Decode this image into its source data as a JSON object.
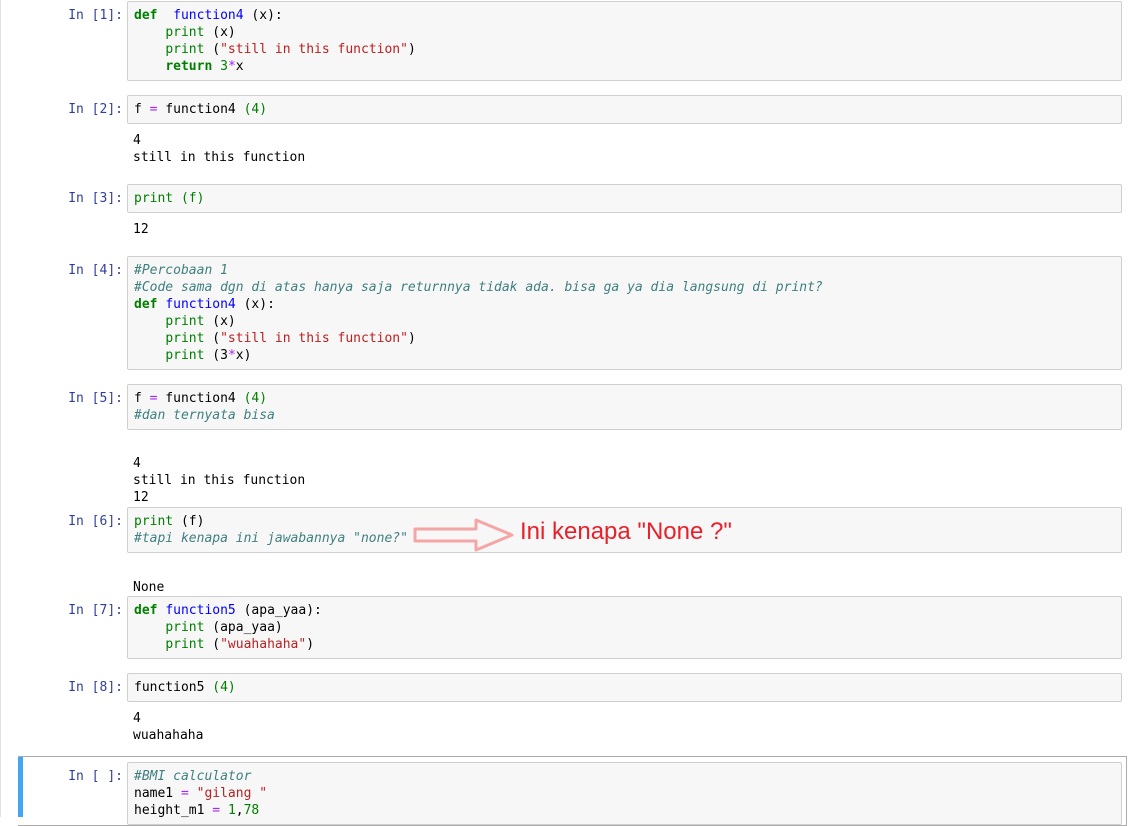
{
  "cells": [
    {
      "prompt": "In [1]:",
      "code": [
        [
          [
            "kw",
            "def"
          ],
          [
            "",
            "  "
          ],
          [
            "fn",
            "function4"
          ],
          [
            "",
            " (x):"
          ]
        ],
        [
          [
            "",
            "    "
          ],
          [
            "bi",
            "print"
          ],
          [
            "",
            " (x)"
          ]
        ],
        [
          [
            "",
            "    "
          ],
          [
            "bi",
            "print"
          ],
          [
            "",
            " ("
          ],
          [
            "str",
            "\"still in this function\""
          ],
          [
            "",
            ")"
          ]
        ],
        [
          [
            "",
            "    "
          ],
          [
            "kw",
            "return"
          ],
          [
            "",
            " "
          ],
          [
            "num",
            "3"
          ],
          [
            "op",
            "*"
          ],
          [
            "",
            "x"
          ]
        ]
      ],
      "output": []
    },
    {
      "prompt": "In [2]:",
      "code": [
        [
          [
            "",
            "f "
          ],
          [
            "op",
            "="
          ],
          [
            "",
            " function4 "
          ],
          [
            "num",
            "(4)"
          ]
        ]
      ],
      "output": [
        "4",
        "still in this function"
      ]
    },
    {
      "prompt": "In [3]:",
      "code": [
        [
          [
            "bi",
            "print"
          ],
          [
            "bi",
            " (f)"
          ]
        ]
      ],
      "output": [
        "12"
      ]
    },
    {
      "prompt": "In [4]:",
      "code": [
        [
          [
            "cm",
            "#Percobaan 1"
          ]
        ],
        [
          [
            "cm",
            "#Code sama dgn di atas hanya saja returnnya tidak ada. bisa ga ya dia langsung di print?"
          ]
        ],
        [
          [
            "kw",
            "def"
          ],
          [
            "",
            " "
          ],
          [
            "fn",
            "function4"
          ],
          [
            "",
            " (x):"
          ]
        ],
        [
          [
            "",
            "    "
          ],
          [
            "bi",
            "print"
          ],
          [
            "",
            " (x)"
          ]
        ],
        [
          [
            "",
            "    "
          ],
          [
            "bi",
            "print"
          ],
          [
            "",
            " ("
          ],
          [
            "str",
            "\"still in this function\""
          ],
          [
            "",
            ")"
          ]
        ],
        [
          [
            "",
            "    "
          ],
          [
            "bi",
            "print"
          ],
          [
            "",
            " (3"
          ],
          [
            "op",
            "*"
          ],
          [
            "",
            "x)"
          ]
        ]
      ],
      "output": []
    },
    {
      "prompt": "In [5]:",
      "code": [
        [
          [
            "",
            "f "
          ],
          [
            "op",
            "="
          ],
          [
            "",
            " function4 "
          ],
          [
            "num",
            "(4)"
          ]
        ],
        [
          [
            "cm",
            "#dan ternyata bisa"
          ]
        ]
      ],
      "output": [
        "4",
        "still in this function",
        "12"
      ]
    },
    {
      "prompt": "In [6]:",
      "code": [
        [
          [
            "bi",
            "print"
          ],
          [
            "",
            " (f)"
          ]
        ],
        [
          [
            "cm",
            "#tapi kenapa ini jawabannya \"none?\""
          ]
        ]
      ],
      "output": [
        "None"
      ]
    },
    {
      "prompt": "In [7]:",
      "code": [
        [
          [
            "kw",
            "def"
          ],
          [
            "",
            " "
          ],
          [
            "fn",
            "function5"
          ],
          [
            "",
            " (apa_yaa):"
          ]
        ],
        [
          [
            "",
            "    "
          ],
          [
            "bi",
            "print"
          ],
          [
            "",
            " (apa_yaa)"
          ]
        ],
        [
          [
            "",
            "    "
          ],
          [
            "bi",
            "print"
          ],
          [
            "",
            " ("
          ],
          [
            "str",
            "\"wuahahaha\""
          ],
          [
            "",
            ")"
          ]
        ]
      ],
      "output": []
    },
    {
      "prompt": "In [8]:",
      "code": [
        [
          [
            "",
            "function5 "
          ],
          [
            "num",
            "(4)"
          ]
        ]
      ],
      "output": [
        "4",
        "wuahahaha"
      ]
    },
    {
      "prompt": "In [ ]:",
      "code": [
        [
          [
            "cm",
            "#BMI calculator"
          ]
        ],
        [
          [
            "",
            "name1 "
          ],
          [
            "op",
            "="
          ],
          [
            "",
            " "
          ],
          [
            "str",
            "\"gilang \""
          ]
        ],
        [
          [
            "",
            "height_m1 "
          ],
          [
            "op",
            "="
          ],
          [
            "",
            " "
          ],
          [
            "num",
            "1"
          ],
          [
            "",
            ","
          ],
          [
            "num",
            "78"
          ]
        ]
      ],
      "output": []
    }
  ],
  "annotation": {
    "text": "Ini kenapa \"None ?\"",
    "color": "#e8202a"
  }
}
